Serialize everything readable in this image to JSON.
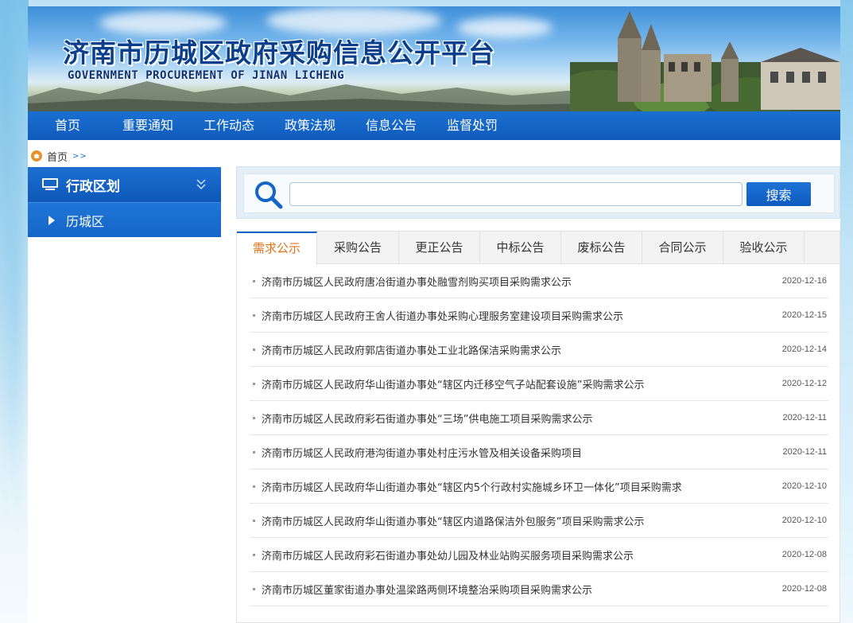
{
  "header": {
    "title_cn": "济南市历城区政府采购信息公开平台",
    "title_en": "GOVERNMENT PROCUREMENT OF JINAN LICHENG"
  },
  "nav": {
    "items": [
      {
        "label": "首页"
      },
      {
        "label": "重要通知"
      },
      {
        "label": "工作动态"
      },
      {
        "label": "政策法规"
      },
      {
        "label": "信息公告"
      },
      {
        "label": "监督处罚"
      }
    ]
  },
  "breadcrumb": {
    "home": "首页",
    "separator": ">>"
  },
  "sidebar": {
    "title": "行政区划",
    "items": [
      {
        "label": "历城区"
      }
    ]
  },
  "search": {
    "value": "",
    "placeholder": "",
    "button_label": "搜索"
  },
  "tabs": [
    {
      "label": "需求公示",
      "active": true
    },
    {
      "label": "采购公告",
      "active": false
    },
    {
      "label": "更正公告",
      "active": false
    },
    {
      "label": "中标公告",
      "active": false
    },
    {
      "label": "废标公告",
      "active": false
    },
    {
      "label": "合同公示",
      "active": false
    },
    {
      "label": "验收公示",
      "active": false
    }
  ],
  "list": [
    {
      "title": "济南市历城区人民政府唐冶街道办事处融雪剂购买项目采购需求公示",
      "date": "2020-12-16"
    },
    {
      "title": "济南市历城区人民政府王舍人街道办事处采购心理服务室建设项目采购需求公示",
      "date": "2020-12-15"
    },
    {
      "title": "济南市历城区人民政府郭店街道办事处工业北路保洁采购需求公示",
      "date": "2020-12-14"
    },
    {
      "title": "济南市历城区人民政府华山街道办事处“辖区内迁移空气子站配套设施”采购需求公示",
      "date": "2020-12-12"
    },
    {
      "title": "济南市历城区人民政府彩石街道办事处“三场”供电施工项目采购需求公示",
      "date": "2020-12-11"
    },
    {
      "title": "济南市历城区人民政府港沟街道办事处村庄污水管及相关设备采购项目",
      "date": "2020-12-11"
    },
    {
      "title": "济南市历城区人民政府华山街道办事处“辖区内5个行政村实施城乡环卫一体化”项目采购需求",
      "date": "2020-12-10"
    },
    {
      "title": "济南市历城区人民政府华山街道办事处“辖区内道路保洁外包服务”项目采购需求公示",
      "date": "2020-12-10"
    },
    {
      "title": "济南市历城区人民政府彩石街道办事处幼儿园及林业站购买服务项目采购需求公示",
      "date": "2020-12-08"
    },
    {
      "title": "济南市历城区董家街道办事处温梁路两侧环境整治采购项目采购需求公示",
      "date": "2020-12-08"
    }
  ],
  "colors": {
    "primary_blue": "#1465c7",
    "active_tab_text": "#e2731b",
    "title_blue": "#0b3f8c"
  }
}
